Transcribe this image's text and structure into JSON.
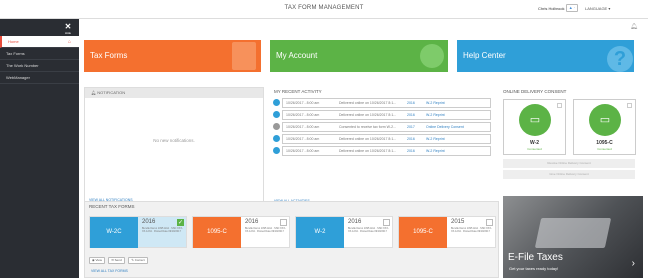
{
  "header": {
    "title": "TAX FORM MANAGEMENT",
    "user": "Chris Holbrook",
    "user_btn": "▲ ·",
    "language": "LANGUAGE ▾"
  },
  "sidebar": {
    "hide_label": "Hide",
    "items": [
      {
        "label": "Home"
      },
      {
        "label": "Tax Forms"
      },
      {
        "label": "The Work Number"
      },
      {
        "label": "WebManager"
      }
    ]
  },
  "tiles": {
    "tax_forms": "Tax Forms",
    "my_account": "My Account",
    "help_center": "Help Center"
  },
  "notification": {
    "heading": "NOTIFICATION",
    "empty": "No new notifications.",
    "view_all": "VIEW ALL NOTIFICATIONS"
  },
  "activity": {
    "heading": "MY RECENT ACTIVITY",
    "rows": [
      {
        "date": "10/26/2017 - 8:00 am",
        "message": "Delivered online on 10/26/2017 8:1...",
        "year": "2016",
        "link": "W-2 Reprint"
      },
      {
        "date": "10/26/2017 - 8:00 am",
        "message": "Delivered online on 10/26/2017 8:1...",
        "year": "2016",
        "link": "W-2 Reprint"
      },
      {
        "date": "10/26/2017 - 8:00 am",
        "message": "Consented to receive tax form W-2...",
        "year": "2017",
        "link": "Online Delivery Consent"
      },
      {
        "date": "10/26/2017 - 8:00 am",
        "message": "Delivered online on 10/26/2017 8:1...",
        "year": "2016",
        "link": "W-2 Reprint"
      },
      {
        "date": "10/26/2017 - 8:00 am",
        "message": "Delivered online on 10/26/2017 8:1...",
        "year": "2016",
        "link": "W-2 Reprint"
      }
    ],
    "view_all": "VIEW ALL ACTIVITIES"
  },
  "consent": {
    "heading": "ONLINE DELIVERY CONSENT",
    "cards": [
      {
        "name": "W-2",
        "status": "Consented"
      },
      {
        "name": "1095-C",
        "status": "Consented"
      }
    ],
    "btn1": "Revoke Online Delivery Consent",
    "btn2": "Give Online Delivery Consent"
  },
  "recent_forms": {
    "heading": "RECENT TAX FORMS",
    "forms": [
      {
        "type": "W-2C",
        "year": "2016",
        "info": "Bundle Demo 1095 ACA · SSN XXX-XX-1234 · Posted Date 09/18/2017"
      },
      {
        "type": "1095-C",
        "year": "2016",
        "info": "Bundle Demo 1095 ACA · SSN XXX-XX-1234 · Posted Date 09/18/2017"
      },
      {
        "type": "W-2",
        "year": "2016",
        "info": "Bundle Demo 1095 ACA · SSN XXX-XX-1234 · Posted Date 09/18/2017"
      },
      {
        "type": "1095-C",
        "year": "2015",
        "info": "Bundle Demo 1095 ACA · SSN XXX-XX-1234 · Posted Date 09/18/2017"
      }
    ],
    "buttons": {
      "view": "View",
      "send": "Send",
      "correct": "Correct"
    },
    "view_all": "VIEW ALL TAX FORMS"
  },
  "promo": {
    "title": "E-File Taxes",
    "subtitle": "Get your taxes ready today!"
  },
  "colors": {
    "orange": "#f4702f",
    "green": "#5cb346",
    "blue": "#2f9fd8",
    "sidebar": "#2a2d33",
    "accent": "#e74c3c"
  }
}
